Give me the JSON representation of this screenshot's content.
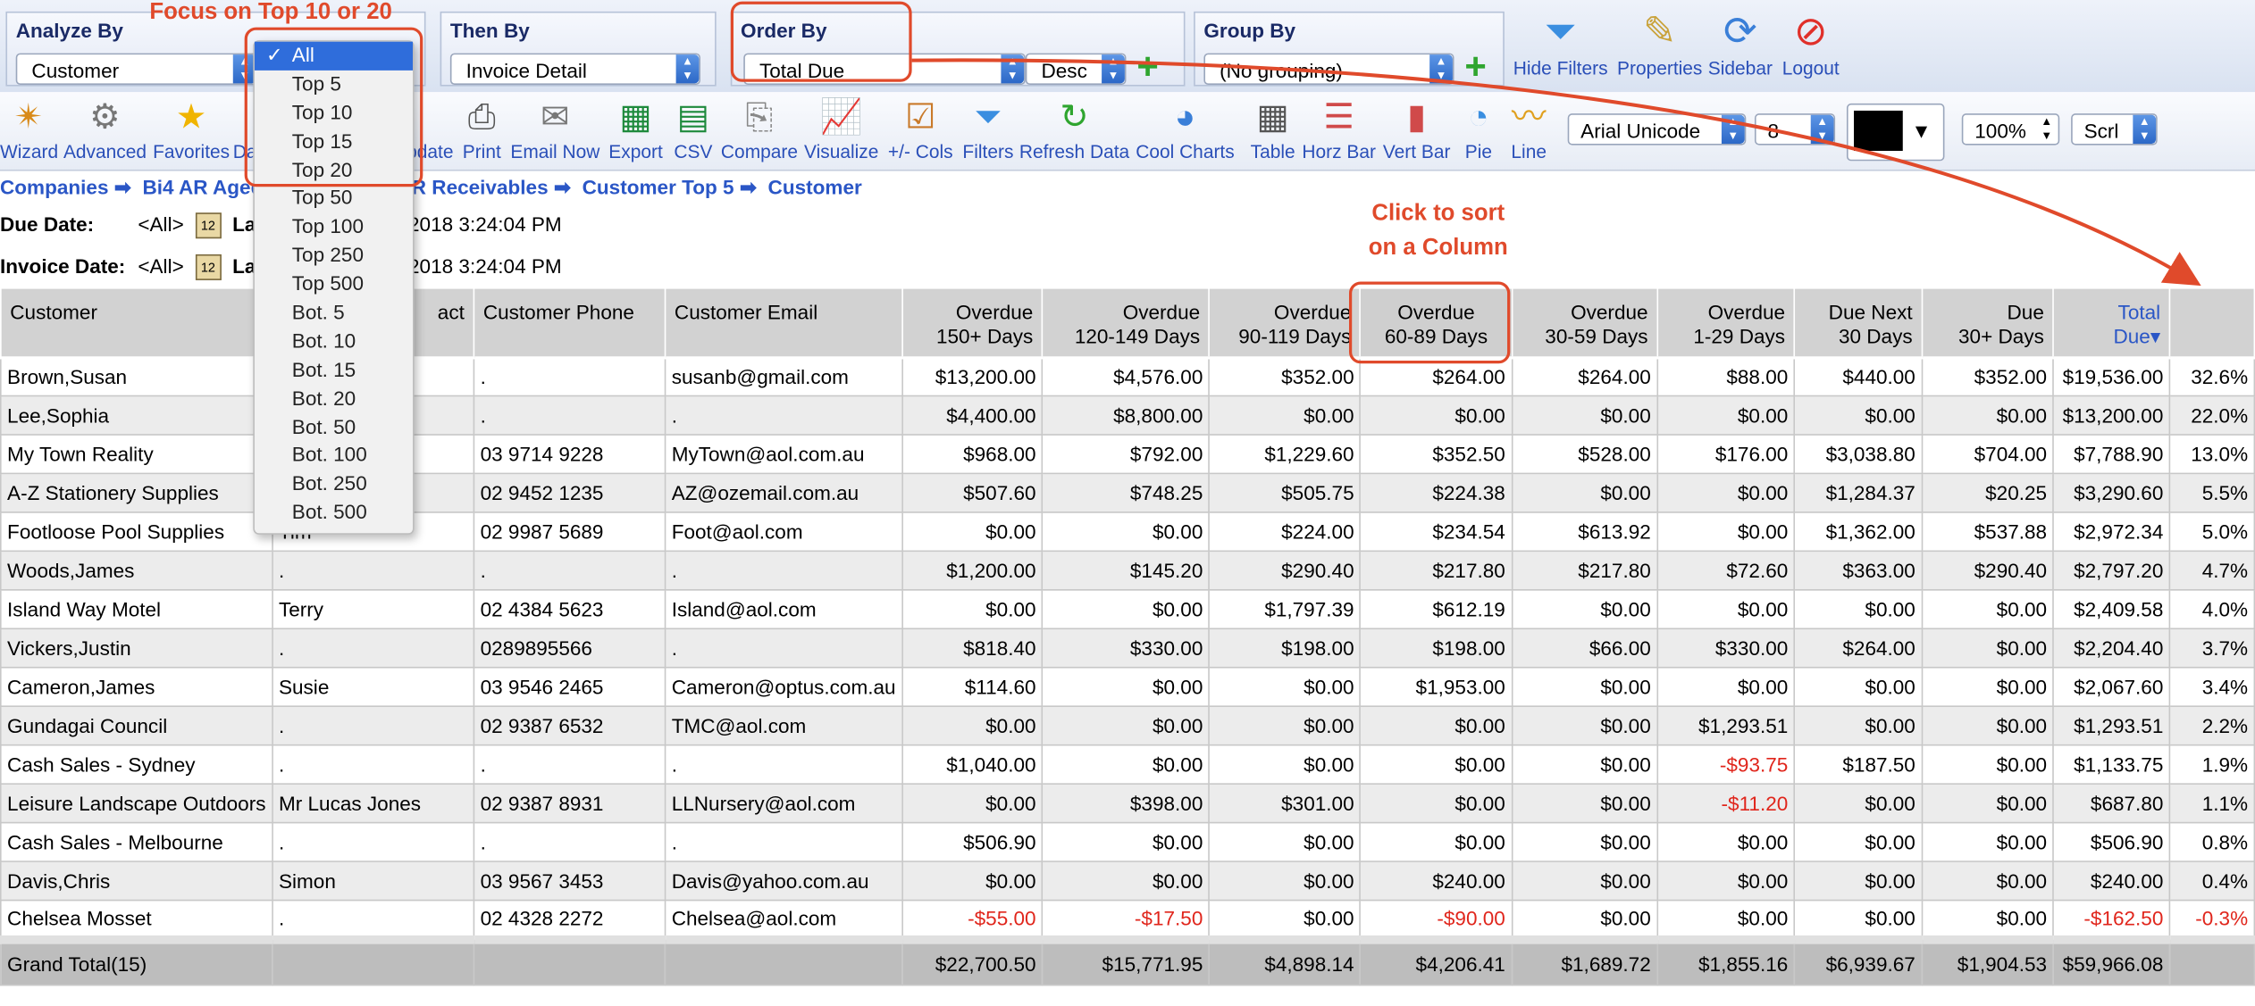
{
  "selectors": {
    "analyze_by": {
      "title": "Analyze By",
      "value": "Customer"
    },
    "then_by": {
      "title": "Then By",
      "value": "Invoice Detail"
    },
    "order_by": {
      "title": "Order By",
      "value": "Total Due",
      "direction": "Desc"
    },
    "group_by": {
      "title": "Group By",
      "value": "(No grouping)"
    }
  },
  "top_buttons": [
    {
      "label": "Hide Filters",
      "icon": "funnel-icon"
    },
    {
      "label": "Properties",
      "icon": "properties-icon"
    },
    {
      "label": "Sidebar",
      "icon": "sidebar-icon"
    },
    {
      "label": "Logout",
      "icon": "logout-icon"
    }
  ],
  "toolbar": [
    {
      "label": "Wizard",
      "icon": "wand-icon"
    },
    {
      "label": "Advanced",
      "icon": "gear-icon"
    },
    {
      "label": "Favorites",
      "icon": "star-icon"
    },
    {
      "label": "Da",
      "icon": "dashboard-icon"
    },
    {
      "label": "pdate",
      "icon": "update-icon"
    },
    {
      "label": "Print",
      "icon": "printer-icon"
    },
    {
      "label": "Email Now",
      "icon": "email-icon"
    },
    {
      "label": "Export",
      "icon": "excel-icon"
    },
    {
      "label": "CSV",
      "icon": "csv-icon"
    },
    {
      "label": "Compare",
      "icon": "compare-icon"
    },
    {
      "label": "Visualize",
      "icon": "visualize-icon"
    },
    {
      "label": "+/- Cols",
      "icon": "columns-icon"
    },
    {
      "label": "Filters",
      "icon": "funnel-icon"
    },
    {
      "label": "Refresh Data",
      "icon": "refresh-icon"
    },
    {
      "label": "Cool Charts",
      "icon": "charts-icon"
    },
    {
      "label": "Table",
      "icon": "table-icon"
    },
    {
      "label": "Horz Bar",
      "icon": "horizontal-bar-icon"
    },
    {
      "label": "Vert Bar",
      "icon": "vertical-bar-icon"
    },
    {
      "label": "Pie",
      "icon": "pie-icon"
    },
    {
      "label": "Line",
      "icon": "line-chart-icon"
    }
  ],
  "format": {
    "font": "Arial Unicode",
    "size": "8",
    "zoom": "100%",
    "scroll": "Scrl",
    "color": "#000000"
  },
  "breadcrumb": [
    "Companies",
    "Bi4 AR Aged",
    "AR Receivables",
    "Customer Top 5",
    "Customer"
  ],
  "filters": [
    {
      "label": "Due Date:",
      "value": "<All>",
      "extra_left": "Las",
      "extra_right": "/2018 3:24:04 PM"
    },
    {
      "label": "Invoice Date:",
      "value": "<All>",
      "extra_left": "Las",
      "extra_right": "/2018 3:24:04 PM"
    }
  ],
  "dropdown": {
    "selected": "All",
    "options": [
      "All",
      "Top 5",
      "Top 10",
      "Top 15",
      "Top 20",
      "Top 50",
      "Top 100",
      "Top 250",
      "Top 500",
      "Bot. 5",
      "Bot. 10",
      "Bot. 15",
      "Bot. 20",
      "Bot. 50",
      "Bot. 100",
      "Bot. 250",
      "Bot. 500"
    ]
  },
  "annotations": {
    "focus": "Focus on Top 10 or 20",
    "sort_line1": "Click to sort",
    "sort_line2": "on a Column"
  },
  "table": {
    "headers": [
      [
        "Customer"
      ],
      [
        "act"
      ],
      [
        "Customer Phone"
      ],
      [
        "Customer Email"
      ],
      [
        "Overdue",
        "150+ Days"
      ],
      [
        "Overdue",
        "120-149 Days"
      ],
      [
        "Overdue",
        "90-119 Days"
      ],
      [
        "Overdue",
        "60-89 Days"
      ],
      [
        "Overdue",
        "30-59 Days"
      ],
      [
        "Overdue",
        "1-29 Days"
      ],
      [
        "Due Next",
        "30 Days"
      ],
      [
        "Due",
        "30+ Days"
      ],
      [
        "Total",
        "Due"
      ],
      [
        ""
      ]
    ],
    "rows": [
      [
        "Brown,Susan",
        "",
        ".",
        "susanb@gmail.com",
        "$13,200.00",
        "$4,576.00",
        "$352.00",
        "$264.00",
        "$264.00",
        "$88.00",
        "$440.00",
        "$352.00",
        "$19,536.00",
        "32.6%"
      ],
      [
        "Lee,Sophia",
        "",
        ".",
        ".",
        "$4,400.00",
        "$8,800.00",
        "$0.00",
        "$0.00",
        "$0.00",
        "$0.00",
        "$0.00",
        "$0.00",
        "$13,200.00",
        "22.0%"
      ],
      [
        "My Town Reality",
        "",
        "03 9714 9228",
        "MyTown@aol.com.au",
        "$968.00",
        "$792.00",
        "$1,229.60",
        "$352.50",
        "$528.00",
        "$176.00",
        "$3,038.80",
        "$704.00",
        "$7,788.90",
        "13.0%"
      ],
      [
        "A-Z Stationery Supplies",
        "",
        "02 9452 1235",
        "AZ@ozemail.com.au",
        "$507.60",
        "$748.25",
        "$505.75",
        "$224.38",
        "$0.00",
        "$0.00",
        "$1,284.37",
        "$20.25",
        "$3,290.60",
        "5.5%"
      ],
      [
        "Footloose Pool Supplies",
        "Tim",
        "02 9987 5689",
        "Foot@aol.com",
        "$0.00",
        "$0.00",
        "$224.00",
        "$234.54",
        "$613.92",
        "$0.00",
        "$1,362.00",
        "$537.88",
        "$2,972.34",
        "5.0%"
      ],
      [
        "Woods,James",
        ".",
        ".",
        ".",
        "$1,200.00",
        "$145.20",
        "$290.40",
        "$217.80",
        "$217.80",
        "$72.60",
        "$363.00",
        "$290.40",
        "$2,797.20",
        "4.7%"
      ],
      [
        "Island Way Motel",
        "Terry",
        "02 4384 5623",
        "Island@aol.com",
        "$0.00",
        "$0.00",
        "$1,797.39",
        "$612.19",
        "$0.00",
        "$0.00",
        "$0.00",
        "$0.00",
        "$2,409.58",
        "4.0%"
      ],
      [
        "Vickers,Justin",
        ".",
        "0289895566",
        ".",
        "$818.40",
        "$330.00",
        "$198.00",
        "$198.00",
        "$66.00",
        "$330.00",
        "$264.00",
        "$0.00",
        "$2,204.40",
        "3.7%"
      ],
      [
        "Cameron,James",
        "Susie",
        "03 9546 2465",
        "Cameron@optus.com.au",
        "$114.60",
        "$0.00",
        "$0.00",
        "$1,953.00",
        "$0.00",
        "$0.00",
        "$0.00",
        "$0.00",
        "$2,067.60",
        "3.4%"
      ],
      [
        "Gundagai Council",
        ".",
        "02 9387 6532",
        "TMC@aol.com",
        "$0.00",
        "$0.00",
        "$0.00",
        "$0.00",
        "$0.00",
        "$1,293.51",
        "$0.00",
        "$0.00",
        "$1,293.51",
        "2.2%"
      ],
      [
        "Cash Sales - Sydney",
        ".",
        ".",
        ".",
        "$1,040.00",
        "$0.00",
        "$0.00",
        "$0.00",
        "$0.00",
        "-$93.75",
        "$187.50",
        "$0.00",
        "$1,133.75",
        "1.9%"
      ],
      [
        "Leisure Landscape Outdoors",
        "Mr Lucas Jones",
        "02 9387 8931",
        "LLNursery@aol.com",
        "$0.00",
        "$398.00",
        "$301.00",
        "$0.00",
        "$0.00",
        "-$11.20",
        "$0.00",
        "$0.00",
        "$687.80",
        "1.1%"
      ],
      [
        "Cash Sales - Melbourne",
        ".",
        ".",
        ".",
        "$506.90",
        "$0.00",
        "$0.00",
        "$0.00",
        "$0.00",
        "$0.00",
        "$0.00",
        "$0.00",
        "$506.90",
        "0.8%"
      ],
      [
        "Davis,Chris",
        "Simon",
        "03 9567 3453",
        "Davis@yahoo.com.au",
        "$0.00",
        "$0.00",
        "$0.00",
        "$240.00",
        "$0.00",
        "$0.00",
        "$0.00",
        "$0.00",
        "$240.00",
        "0.4%"
      ],
      [
        "Chelsea Mosset",
        ".",
        "02 4328 2272",
        "Chelsea@aol.com",
        "-$55.00",
        "-$17.50",
        "$0.00",
        "-$90.00",
        "$0.00",
        "$0.00",
        "$0.00",
        "$0.00",
        "-$162.50",
        "-0.3%"
      ]
    ],
    "total": [
      "Grand Total(15)",
      "",
      "",
      "",
      "$22,700.50",
      "$15,771.95",
      "$4,898.14",
      "$4,206.41",
      "$1,689.72",
      "$1,855.16",
      "$6,939.67",
      "$1,904.53",
      "$59,966.08",
      ""
    ]
  },
  "colors": {
    "accent": "#2a56c6",
    "negative": "#e0251b",
    "annotation": "#e04a2b",
    "selected": "#2f6ddb"
  }
}
